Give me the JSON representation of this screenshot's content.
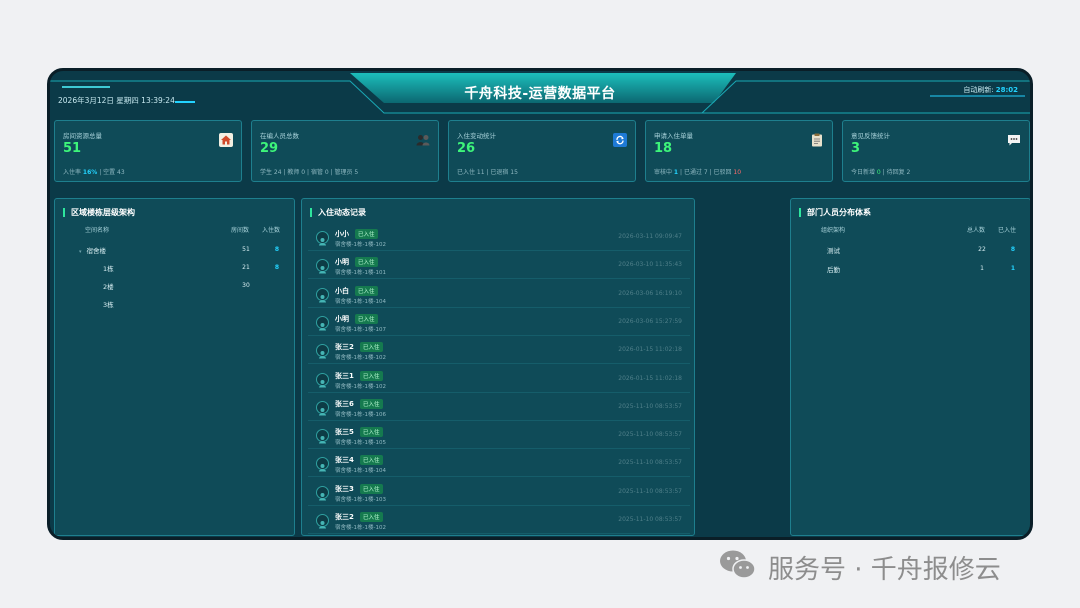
{
  "header": {
    "datetime": "2026年3月12日 星期四 13:39:24",
    "title": "千舟科技-运营数据平台",
    "refresh_label": "自动刷新:",
    "refresh_value": "28:02"
  },
  "cards": [
    {
      "label": "房间资源总量",
      "value": "51",
      "icon": "home-icon",
      "sub": [
        {
          "t": "入住率 "
        },
        {
          "t": "16%",
          "c": "hl"
        },
        {
          "t": " | 空置 43"
        }
      ]
    },
    {
      "label": "在编人员总数",
      "value": "29",
      "icon": "users-icon",
      "sub": [
        {
          "t": "学生 24 | 教师 0 | 宿管 0 | 管理员 5"
        }
      ]
    },
    {
      "label": "入住变动统计",
      "value": "26",
      "icon": "refresh-icon",
      "sub": [
        {
          "t": "已入住 11 | 已退宿 15"
        }
      ]
    },
    {
      "label": "申请入住单量",
      "value": "18",
      "icon": "clipboard-icon",
      "sub": [
        {
          "t": "审核中 "
        },
        {
          "t": "1",
          "c": "hl"
        },
        {
          "t": " | 已通过 7 | 已驳回 "
        },
        {
          "t": "10",
          "c": "red"
        }
      ]
    },
    {
      "label": "意见反馈统计",
      "value": "3",
      "icon": "chat-icon",
      "sub": [
        {
          "t": "今日新增 "
        },
        {
          "t": "0",
          "c": "grn"
        },
        {
          "t": " | 待回复 2"
        }
      ]
    }
  ],
  "left_panel": {
    "title": "区域楼栋层级架构",
    "headers": [
      "空间名称",
      "房间数",
      "入住数"
    ],
    "rows": [
      {
        "name": "宿舍楼",
        "rooms": "51",
        "occupied": "8",
        "expand": "▾"
      },
      {
        "name": "1栋",
        "rooms": "21",
        "occupied": "8",
        "expand": ""
      },
      {
        "name": "2楼",
        "rooms": "30",
        "occupied": "",
        "expand": ""
      },
      {
        "name": "3栋",
        "rooms": "",
        "occupied": "",
        "expand": ""
      }
    ]
  },
  "mid_panel": {
    "title": "入住动态记录",
    "records": [
      {
        "name": "小小",
        "status": "已入住",
        "location": "宿舍楼-1栋-1楼-102",
        "time": "2026-03-11 09:09:47"
      },
      {
        "name": "小明",
        "status": "已入住",
        "location": "宿舍楼-1栋-1楼-101",
        "time": "2026-03-10 11:35:43"
      },
      {
        "name": "小白",
        "status": "已入住",
        "location": "宿舍楼-1栋-1楼-104",
        "time": "2026-03-06 16:19:10"
      },
      {
        "name": "小明",
        "status": "已入住",
        "location": "宿舍楼-1栋-1楼-107",
        "time": "2026-03-06 15:27:59"
      },
      {
        "name": "张三2",
        "status": "已入住",
        "location": "宿舍楼-1栋-1楼-102",
        "time": "2026-01-15 11:02:18"
      },
      {
        "name": "张三1",
        "status": "已入住",
        "location": "宿舍楼-1栋-1楼-102",
        "time": "2026-01-15 11:02:18"
      },
      {
        "name": "张三6",
        "status": "已入住",
        "location": "宿舍楼-1栋-1楼-106",
        "time": "2025-11-10 08:53:57"
      },
      {
        "name": "张三5",
        "status": "已入住",
        "location": "宿舍楼-1栋-1楼-105",
        "time": "2025-11-10 08:53:57"
      },
      {
        "name": "张三4",
        "status": "已入住",
        "location": "宿舍楼-1栋-1楼-104",
        "time": "2025-11-10 08:53:57"
      },
      {
        "name": "张三3",
        "status": "已入住",
        "location": "宿舍楼-1栋-1楼-103",
        "time": "2025-11-10 08:53:57"
      },
      {
        "name": "张三2",
        "status": "已入住",
        "location": "宿舍楼-1栋-1楼-102",
        "time": "2025-11-10 08:53:57"
      }
    ]
  },
  "right_panel": {
    "title": "部门人员分布体系",
    "headers": [
      "组织架构",
      "总人数",
      "已入住"
    ],
    "rows": [
      {
        "name": "测试",
        "total": "22",
        "occupied": "8"
      },
      {
        "name": "后勤",
        "total": "1",
        "occupied": "1"
      }
    ]
  },
  "watermark": {
    "text": "服务号 · 千舟报修云",
    "icon": "wechat-icon"
  },
  "colors": {
    "bg": "#0b3a48",
    "panel": "#0f4b58",
    "accent_green": "#3df57a",
    "accent_cyan": "#23d3ff",
    "border": "#1e7f8e"
  }
}
